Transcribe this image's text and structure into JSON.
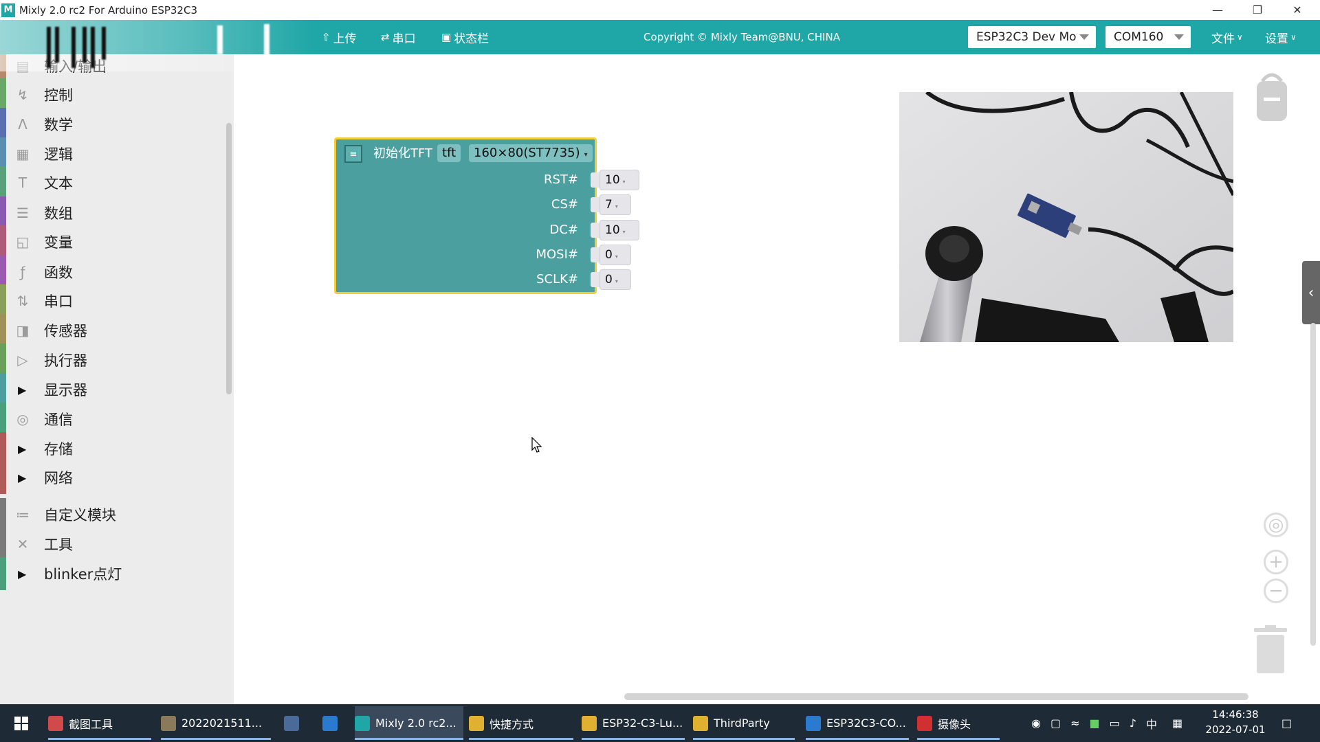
{
  "window": {
    "title": "Mixly 2.0 rc2 For Arduino ESP32C3",
    "logo_text": "M",
    "controls": [
      "minimize",
      "restore",
      "close"
    ]
  },
  "toolbar": {
    "upload_label": "上传",
    "serial_label": "串口",
    "statusbar_label": "状态栏",
    "copyright": "Copyright © Mixly Team@BNU, CHINA",
    "board_select": "ESP32C3 Dev Mo",
    "port_select": "COM160",
    "file_menu": "文件",
    "settings_menu": "设置",
    "accent_color": "#1fa6a6"
  },
  "sidebar": {
    "categories": [
      {
        "label": "输入/输出",
        "icon": "io-icon",
        "color": "#b58a6a"
      },
      {
        "label": "控制",
        "icon": "control-icon",
        "color": "#6aa86a"
      },
      {
        "label": "数学",
        "icon": "math-icon",
        "color": "#5a6fb0"
      },
      {
        "label": "逻辑",
        "icon": "logic-icon",
        "color": "#5a8fb0"
      },
      {
        "label": "文本",
        "icon": "text-icon",
        "color": "#5aa07a"
      },
      {
        "label": "数组",
        "icon": "array-icon",
        "color": "#8a5ab0"
      },
      {
        "label": "变量",
        "icon": "variable-icon",
        "color": "#b05a7a"
      },
      {
        "label": "函数",
        "icon": "function-icon",
        "color": "#9a5ab0"
      },
      {
        "label": "串口",
        "icon": "serial-icon",
        "color": "#8aa05a"
      },
      {
        "label": "传感器",
        "icon": "sensor-icon",
        "color": "#a0905a"
      },
      {
        "label": "执行器",
        "icon": "actuator-icon",
        "color": "#6aa05a"
      },
      {
        "label": "显示器",
        "icon": "arrow",
        "color": "#4c9f9f"
      },
      {
        "label": "通信",
        "icon": "comm-icon",
        "color": "#4aa07a"
      },
      {
        "label": "存储",
        "icon": "arrow",
        "color": "#b05a5a"
      },
      {
        "label": "网络",
        "icon": "arrow",
        "color": "#b05a5a"
      },
      {
        "label": "自定义模块",
        "icon": "custom-icon",
        "color": "#7a7a7a"
      },
      {
        "label": "工具",
        "icon": "tools-icon",
        "color": "#7a7a7a"
      },
      {
        "label": "blinker点灯",
        "icon": "arrow",
        "color": "#4aa07a"
      }
    ]
  },
  "block": {
    "title": "初始化TFT",
    "var_name": "tft",
    "model": "160×80(ST7735)",
    "pins": [
      {
        "label": "RST#",
        "value": "10"
      },
      {
        "label": "CS#",
        "value": "7"
      },
      {
        "label": "DC#",
        "value": "10"
      },
      {
        "label": "MOSI#",
        "value": "0"
      },
      {
        "label": "SCLK#",
        "value": "0"
      }
    ]
  },
  "taskbar": {
    "items": [
      {
        "label": "截图工具",
        "color": "#d04a4a"
      },
      {
        "label": "2022021511...",
        "color": "#8a7a5a"
      },
      {
        "label": "",
        "color": "#4a6a9a"
      },
      {
        "label": "",
        "color": "#2a7ad0"
      },
      {
        "label": "Mixly 2.0 rc2...",
        "color": "#1fa6a6"
      },
      {
        "label": "快捷方式",
        "color": "#e0b030"
      },
      {
        "label": "ESP32-C3-Lu...",
        "color": "#e0b030"
      },
      {
        "label": "ThirdParty",
        "color": "#e0b030"
      },
      {
        "label": "ESP32C3-CO...",
        "color": "#2a7ad0"
      },
      {
        "label": "摄像头",
        "color": "#d03030"
      }
    ],
    "ime": "中",
    "time": "14:46:38",
    "date": "2022-07-01"
  }
}
